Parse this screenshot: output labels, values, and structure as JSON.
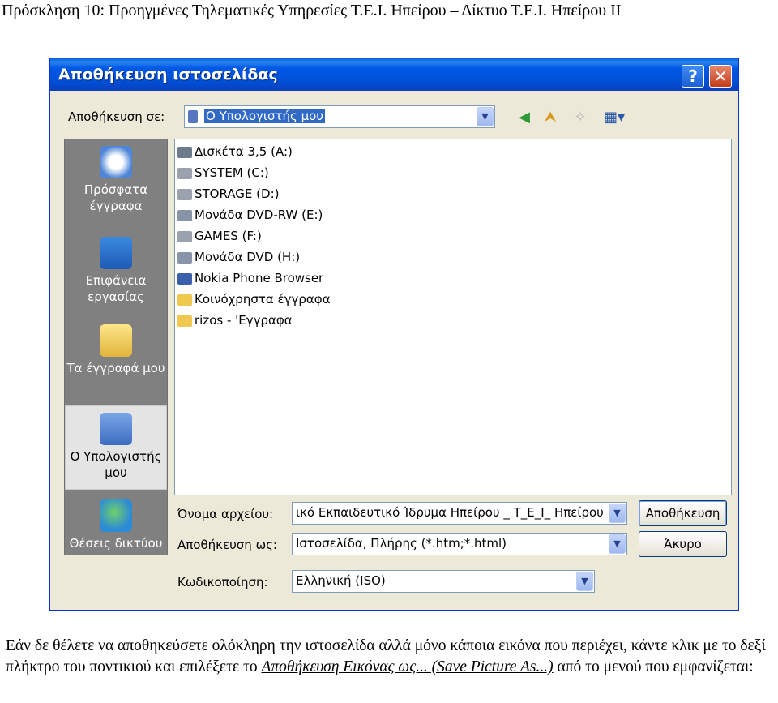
{
  "page": {
    "heading": "Πρόσκληση 10: Προηγμένες Τηλεματικές Υπηρεσίες Τ.Ε.Ι. Ηπείρου – Δίκτυο Τ.Ε.Ι. Ηπείρου ΙΙ",
    "paragraph_start": "Εάν δε θέλετε να αποθηκεύσετε ολόκληρη την ιστοσελίδα αλλά μόνο κάποια εικόνα που περιέχει, κάντε κλικ με το δεξί πλήκτρο του ποντικιού και επιλέξετε το ",
    "paragraph_link": "Αποθήκευση Εικόνας ως... (Save Picture As...)",
    "paragraph_end": " από το μενού που εμφανίζεται:"
  },
  "dialog": {
    "title": "Αποθήκευση ιστοσελίδας",
    "help_glyph": "?",
    "close_glyph": "✕",
    "save_in_label": "Αποθήκευση σε:",
    "save_in_value": "Ο Υπολογιστής μου",
    "toolbar_icons": [
      "back-icon",
      "up-folder-icon",
      "new-folder-icon",
      "views-menu-icon"
    ],
    "places": [
      {
        "label": "Πρόσφατα έγγραφα",
        "icon": "recent-documents-icon"
      },
      {
        "label": "Επιφάνεια εργασίας",
        "icon": "desktop-icon"
      },
      {
        "label": "Τα έγγραφά μου",
        "icon": "my-documents-icon"
      },
      {
        "label": "Ο Υπολογιστής μου",
        "icon": "my-computer-icon",
        "selected": true
      },
      {
        "label": "Θέσεις δικτύου",
        "icon": "network-places-icon"
      }
    ],
    "items": [
      {
        "label": "Δισκέτα 3,5 (A:)",
        "icon": "floppy-drive-icon",
        "color": "#6b7b8c"
      },
      {
        "label": "SYSTEM (C:)",
        "icon": "hard-drive-icon",
        "color": "#9aa3ad"
      },
      {
        "label": "STORAGE (D:)",
        "icon": "hard-drive-icon",
        "color": "#9aa3ad"
      },
      {
        "label": "Μονάδα DVD-RW (E:)",
        "icon": "dvd-drive-icon",
        "color": "#8894a8"
      },
      {
        "label": "GAMES (F:)",
        "icon": "hard-drive-icon",
        "color": "#9aa3ad"
      },
      {
        "label": "Μονάδα DVD (H:)",
        "icon": "dvd-drive-icon",
        "color": "#8894a8"
      },
      {
        "label": "Nokia Phone Browser",
        "icon": "phone-browser-icon",
        "color": "#3b5fa8"
      },
      {
        "label": "Κοινόχρηστα έγγραφα",
        "icon": "folder-icon",
        "color": "#f0c850"
      },
      {
        "label": "rizos - 'Εγγραφα",
        "icon": "folder-icon",
        "color": "#f0c850"
      }
    ],
    "filename_label": "Όνομα αρχείου:",
    "filename_value": "ικό Εκπαιδευτικό Ίδρυμα Ηπείρου _ Τ_Ε_Ι_ Ηπείρου",
    "savetype_label": "Αποθήκευση ως:",
    "savetype_value": "Ιστοσελίδα, Πλήρης (*.htm;*.html)",
    "encoding_label": "Κωδικοποίηση:",
    "encoding_value": "Ελληνική (ISO)",
    "save_button": "Αποθήκευση",
    "cancel_button": "Άκυρο",
    "dropdown_glyph": "▼"
  }
}
